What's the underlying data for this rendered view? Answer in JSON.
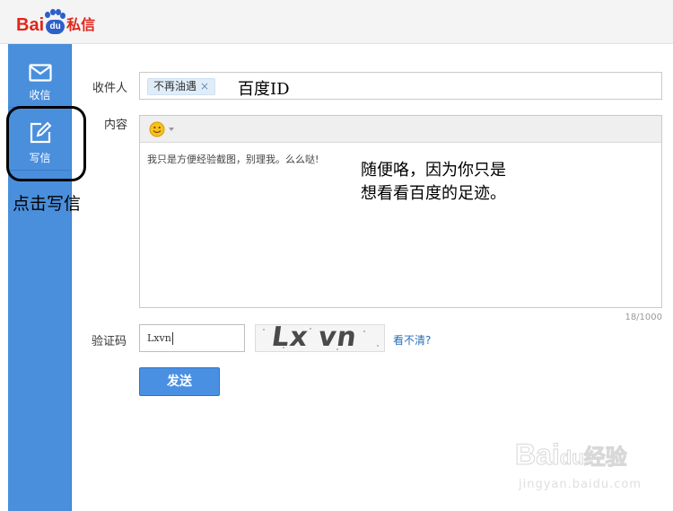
{
  "app": {
    "logo_prefix": "Bai",
    "logo_du": "du",
    "logo_product": "私信"
  },
  "sidebar": {
    "items": [
      {
        "label": "收信",
        "icon": "envelope-icon"
      },
      {
        "label": "写信",
        "icon": "edit-icon"
      }
    ],
    "annotation": "点击写信"
  },
  "form": {
    "recipient_label": "收件人",
    "recipient_tag": "不再油遇",
    "recipient_remove": "×",
    "recipient_annotation": "百度ID",
    "content_label": "内容",
    "content_text": "我只是方便经验截图，别理我。么么哒!",
    "content_annotation_line1": "随便咯，因为你只是",
    "content_annotation_line2": "想看看百度的足迹。",
    "char_counter": "18/1000",
    "captcha_label": "验证码",
    "captcha_value": "Lxvn",
    "captcha_image_text": "Lx vn",
    "captcha_refresh": "看不清?",
    "send_label": "发送"
  },
  "watermark": {
    "brand": "Bai",
    "brand_du": "du",
    "brand_product": "经验",
    "url": "jingyan.baidu.com"
  },
  "colors": {
    "sidebar": "#4a8fdc",
    "brand_red": "#e1251b",
    "brand_blue": "#2d5fc8",
    "button": "#4a90e2",
    "link": "#2a6fb8"
  }
}
